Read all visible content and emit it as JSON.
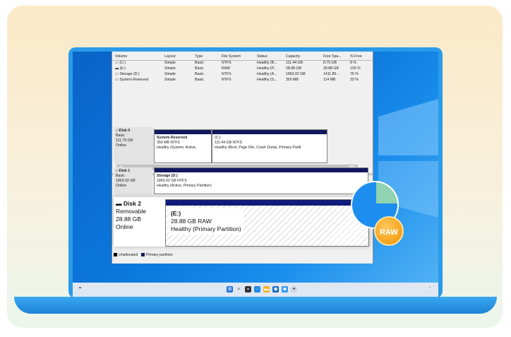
{
  "volume_table": {
    "headers": [
      "Volume",
      "Layout",
      "Type",
      "File System",
      "Status",
      "Capacity",
      "Free Spa...",
      "% Free"
    ],
    "rows": [
      [
        "(C:)",
        "Simple",
        "Basic",
        "NTFS",
        "Healthy (B...",
        "111.44 GB",
        "8.75 GB",
        "8 %"
      ],
      [
        "(E:)",
        "Simple",
        "Basic",
        "RAW",
        "Healthy (P...",
        "28.88 GB",
        "28.88 GB",
        "100 %"
      ],
      [
        "Storage (D:)",
        "Simple",
        "Basic",
        "NTFS",
        "Healthy (A...",
        "1863.02 GB",
        "1411.80 ...",
        "76 %"
      ],
      [
        "System Reserved",
        "Simple",
        "Basic",
        "NTFS",
        "Healthy (S...",
        "350 MB",
        "114 MB",
        "33 %"
      ]
    ]
  },
  "disk0": {
    "label": "Disk 0",
    "type": "Basic",
    "size": "111.79 GB",
    "status": "Online",
    "partitions": [
      {
        "name": "System Reserved",
        "size": "350 MB NTFS",
        "status": "Healthy (System, Active,"
      },
      {
        "name": "(C:)",
        "size": "111.44 GB NTFS",
        "status": "Healthy (Boot, Page File, Crash Dump, Primary Partit"
      }
    ]
  },
  "disk1": {
    "label": "Disk 1",
    "type": "Basic",
    "size": "1863.02 GB",
    "status": "Online",
    "partition": {
      "name": "Storage (D:)",
      "size": "1863.02 GB NTFS",
      "status": "Healthy (Active, Primary Partition)"
    }
  },
  "disk2": {
    "label": "Disk 2",
    "type": "Removable",
    "size": "28.88 GB",
    "status": "Online",
    "partition": {
      "name": "(E:)",
      "size": "28.88 GB RAW",
      "status": "Healthy (Primary Partition)"
    }
  },
  "legend": {
    "unallocated": "Unallocated",
    "primary": "Primary partition"
  },
  "raw_badge": "RAW",
  "colors": {
    "primary_bar": "#12185f",
    "badge": "#f4a21c",
    "pie": "#1d8ef0"
  }
}
